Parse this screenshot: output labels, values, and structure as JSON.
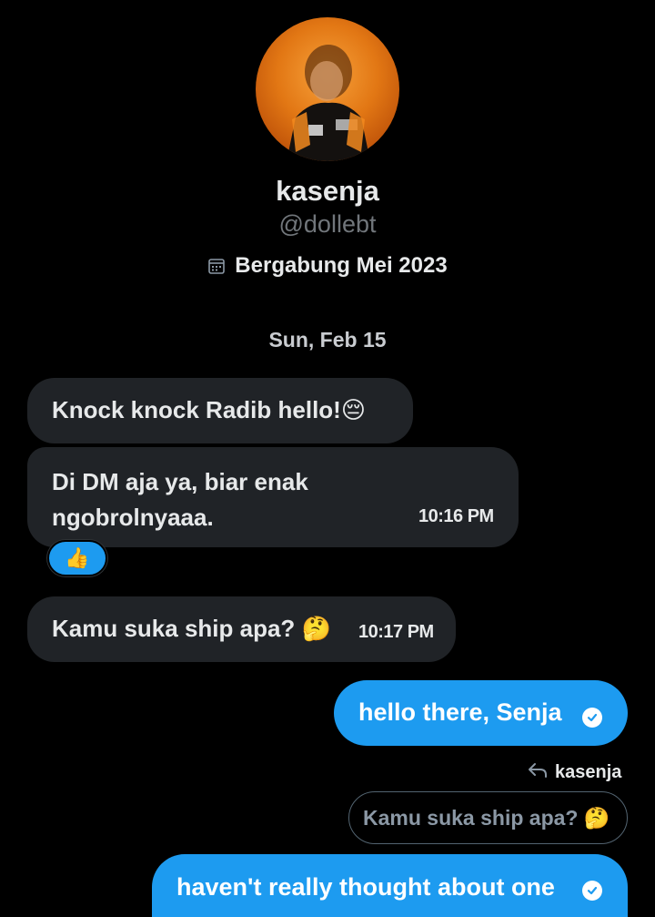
{
  "profile": {
    "display_name": "kasenja",
    "handle": "@dollebt",
    "joined": "Bergabung Mei 2023",
    "joined_icon": "calendar-icon"
  },
  "conversation": {
    "date_separator": "Sun, Feb 15",
    "messages": [
      {
        "direction": "incoming",
        "text": "Knock knock Radib hello!",
        "emoji": "😔"
      },
      {
        "direction": "incoming",
        "lines": [
          "Di DM aja ya, biar enak",
          "ngobrolnyaaa."
        ],
        "time": "10:16 PM",
        "reaction": "👍"
      },
      {
        "direction": "incoming",
        "text": "Kamu suka ship apa?",
        "emoji": "🤔",
        "time": "10:17 PM"
      },
      {
        "direction": "outgoing",
        "text": "hello there, Senja",
        "status_icon": "check-circle-icon"
      },
      {
        "direction": "outgoing",
        "reply_to_user": "kasenja",
        "reply_icon": "reply-arrow-icon",
        "quoted_text": "Kamu suka ship apa?",
        "quoted_emoji": "🤔",
        "text": "haven't really thought about one",
        "status_icon": "check-circle-icon"
      }
    ]
  },
  "colors": {
    "background": "#000000",
    "incoming_bubble": "#202327",
    "outgoing_bubble": "#1d9bf0",
    "muted_text": "#71767b"
  }
}
